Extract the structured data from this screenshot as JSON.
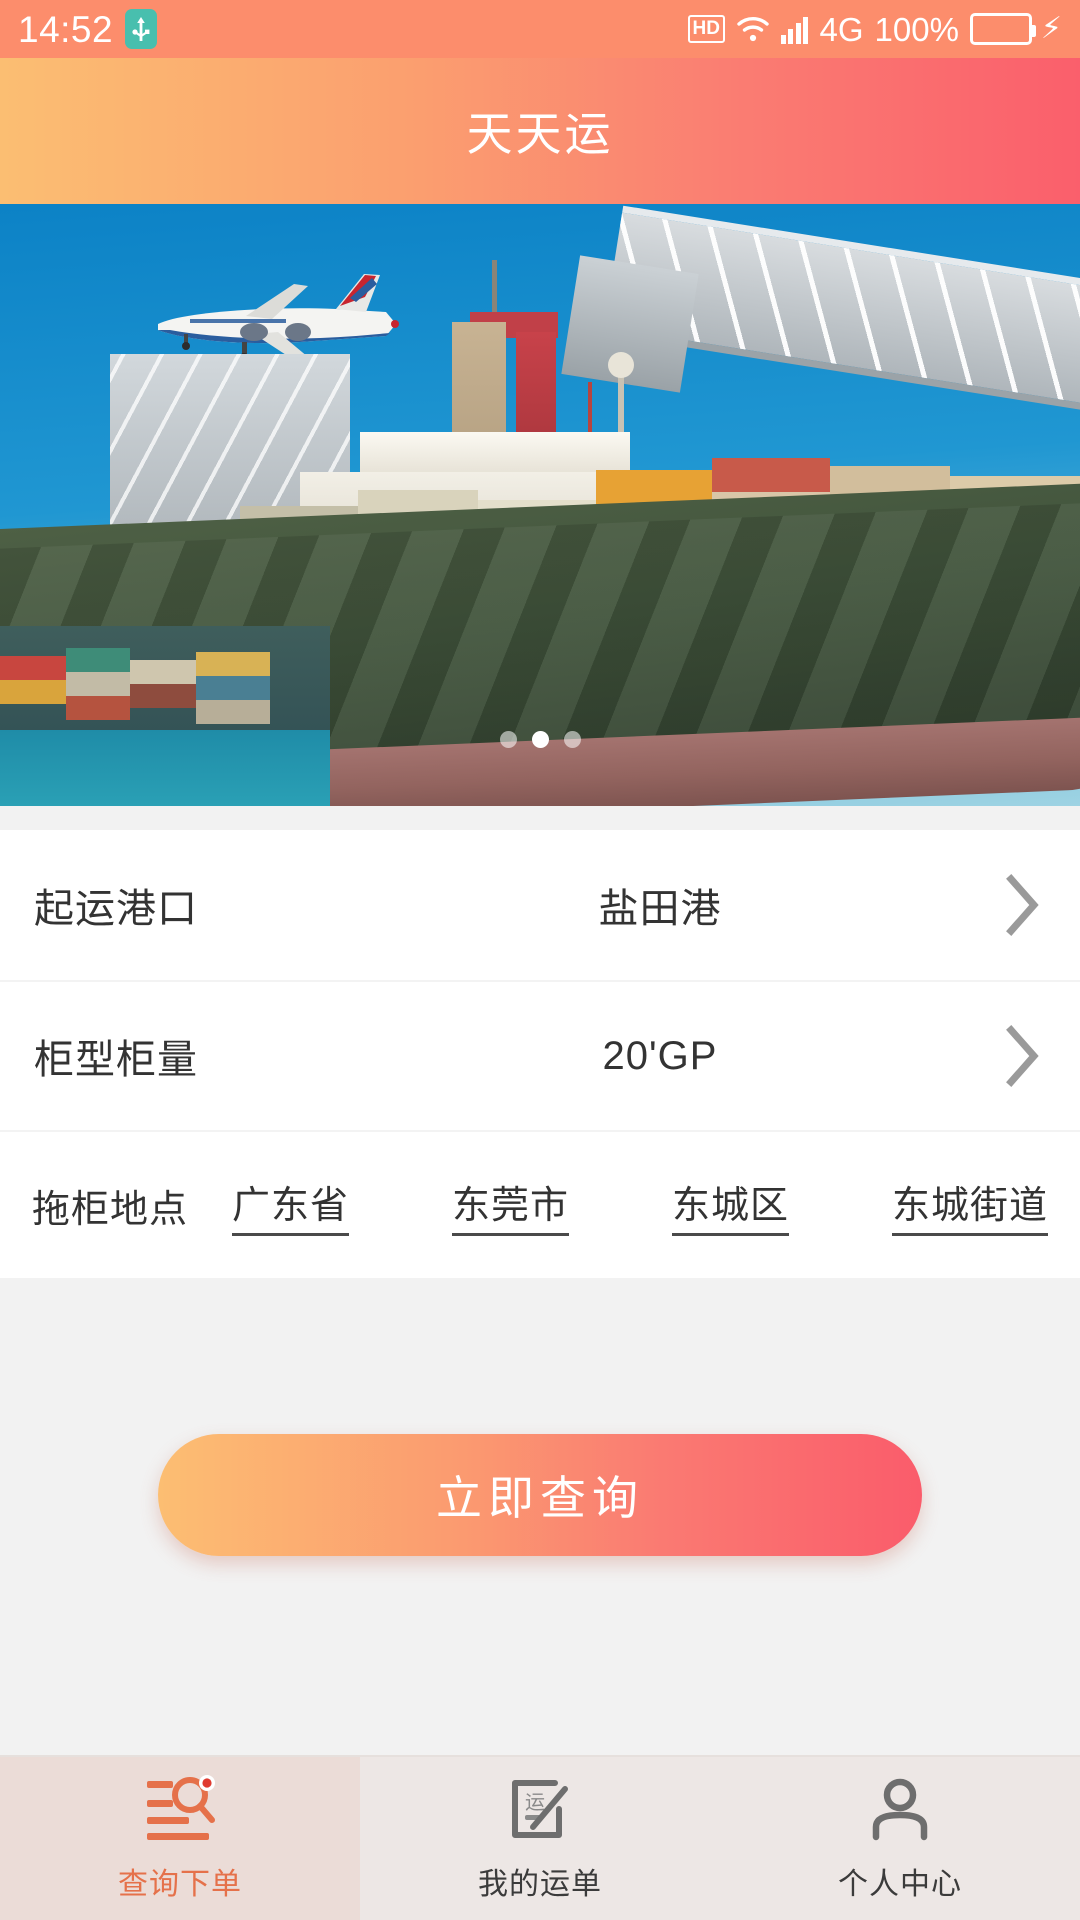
{
  "status_bar": {
    "time": "14:52",
    "usb_icon": "usb-icon",
    "hd_label": "HD",
    "wifi_icon": "wifi-icon",
    "signal_icon": "signal-bars-icon",
    "network": "4G",
    "battery_percent": "100%",
    "battery_icon": "battery-icon",
    "charging_icon": "charging-bolt-icon",
    "bg_color": "#FC8D6C",
    "usb_badge_color": "#48BFAE",
    "battery_fill_color": "#4CC764"
  },
  "header": {
    "title": "天天运",
    "gradient_from": "#FBBE72",
    "gradient_to": "#FA5F6C"
  },
  "carousel": {
    "name": "banner-carousel",
    "slide_alt": "货轮集装箱码头与飞机",
    "total_slides": 3,
    "active_slide": 2,
    "dots": [
      "dot-1",
      "dot-2",
      "dot-3"
    ]
  },
  "form": {
    "rows": [
      {
        "label": "起运港口",
        "value": "盐田港",
        "chevron": "chevron-right-icon",
        "name": "departure-port"
      },
      {
        "label": "柜型柜量",
        "value": "20'GP",
        "chevron": "chevron-right-icon",
        "name": "container-type"
      }
    ],
    "address_row": {
      "label": "拖柜地点",
      "name": "pickup-location",
      "links": [
        "广东省",
        "东莞市",
        "东城区",
        "东城街道"
      ]
    }
  },
  "query_button": {
    "label": "立即查询",
    "gradient_from": "#FCBE72",
    "gradient_to": "#FA5C6B"
  },
  "tabbar": {
    "active_color": "#E5714A",
    "inactive_color": "#3b3b3b",
    "active_bg": "#EBDCD7",
    "bg": "#EDE7E5",
    "items": [
      {
        "label": "查询下单",
        "icon": "list-search-icon",
        "active": true,
        "badge": true
      },
      {
        "label": "我的运单",
        "icon": "waybill-edit-icon",
        "active": false,
        "badge": false
      },
      {
        "label": "个人中心",
        "icon": "person-icon",
        "active": false,
        "badge": false
      }
    ]
  }
}
